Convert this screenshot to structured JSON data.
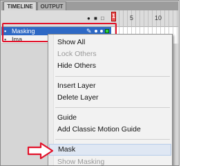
{
  "tabs": [
    {
      "label": "TIMELINE",
      "active": true
    },
    {
      "label": "OUTPUT",
      "active": false
    }
  ],
  "timeline_header": {
    "frame_numbers": [
      "1",
      "5",
      "10"
    ],
    "current_frame": "1"
  },
  "layers": [
    {
      "name": "Masking",
      "selected": true
    },
    {
      "name": "Ima",
      "selected": false
    }
  ],
  "context_menu": {
    "items": [
      {
        "label": "Show All",
        "enabled": true
      },
      {
        "label": "Lock Others",
        "enabled": false
      },
      {
        "label": "Hide Others",
        "enabled": true
      },
      {
        "label": "Insert Layer",
        "enabled": true
      },
      {
        "label": "Delete Layer",
        "enabled": true
      },
      {
        "label": "Guide",
        "enabled": true
      },
      {
        "label": "Add Classic Motion Guide",
        "enabled": true
      },
      {
        "label": "Mask",
        "enabled": true,
        "hover": true
      },
      {
        "label": "Show Masking",
        "enabled": false
      }
    ]
  },
  "colors": {
    "selected_layer": "#2e69c5",
    "annotation_red": "#e2122a",
    "menu_hover": "#dfe7f3"
  }
}
